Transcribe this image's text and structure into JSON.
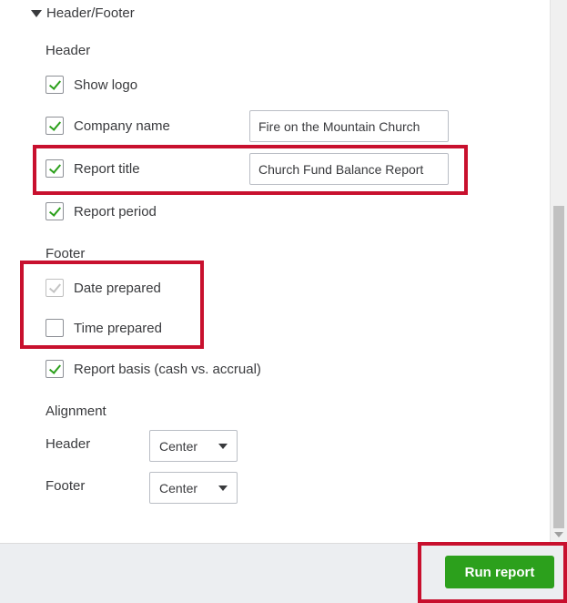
{
  "section_title": "Header/Footer",
  "header_group": {
    "label": "Header",
    "items": [
      {
        "label": "Show logo",
        "checked": true
      },
      {
        "label": "Company name",
        "checked": true,
        "value": "Fire on the Mountain Church"
      },
      {
        "label": "Report title",
        "checked": true,
        "value": "Church Fund Balance Report"
      },
      {
        "label": "Report period",
        "checked": true
      }
    ]
  },
  "footer_group": {
    "label": "Footer",
    "items": [
      {
        "label": "Date prepared",
        "checked": true,
        "disabled": true
      },
      {
        "label": "Time prepared",
        "checked": false
      },
      {
        "label": "Report basis (cash vs. accrual)",
        "checked": true
      }
    ]
  },
  "alignment": {
    "label": "Alignment",
    "header_label": "Header",
    "header_value": "Center",
    "footer_label": "Footer",
    "footer_value": "Center"
  },
  "run_report_label": "Run report",
  "colors": {
    "accent_green": "#2ca01c",
    "highlight_red": "#c8102e",
    "footer_bg": "#eceef1"
  }
}
